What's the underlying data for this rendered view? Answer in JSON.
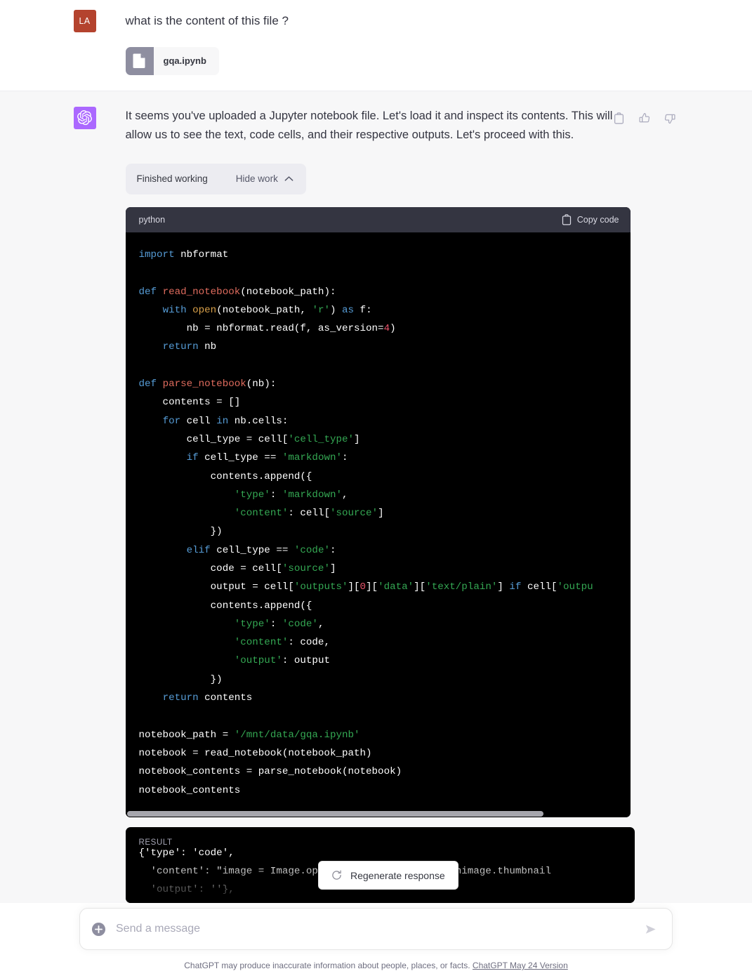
{
  "user_turn": {
    "avatar_initials": "LA",
    "avatar_color": "#b4432e",
    "text": "what is the content of this file ?",
    "attachment": {
      "filename": "gqa.ipynb",
      "icon": "file-icon"
    }
  },
  "assistant_turn": {
    "avatar_color": "#ab68ff",
    "avatar_icon": "openai-logo-icon",
    "text": "It seems you've uploaded a Jupyter notebook file. Let's load it and inspect its contents. This will allow us to see the text, code cells, and their respective outputs. Let's proceed with this.",
    "actions": [
      {
        "name": "copy-icon",
        "label": "Copy"
      },
      {
        "name": "thumbs-up-icon",
        "label": "Good response"
      },
      {
        "name": "thumbs-down-icon",
        "label": "Bad response"
      }
    ],
    "work_pill": {
      "status": "Finished working",
      "toggle_label": "Hide work",
      "chevron": "chevron-up-icon"
    },
    "code_block": {
      "language": "python",
      "copy_label": "Copy code",
      "copy_icon": "clipboard-icon",
      "scrollbar_thumb_percent": 83,
      "code_lines": [
        [
          [
            "kw",
            "import"
          ],
          [
            "pl",
            " nbformat"
          ]
        ],
        [],
        [
          [
            "kw",
            "def"
          ],
          [
            "pl",
            " "
          ],
          [
            "fn",
            "read_notebook"
          ],
          [
            "pl",
            "(notebook_path):"
          ]
        ],
        [
          [
            "pl",
            "    "
          ],
          [
            "kw",
            "with"
          ],
          [
            "pl",
            " "
          ],
          [
            "bi",
            "open"
          ],
          [
            "pl",
            "(notebook_path, "
          ],
          [
            "str",
            "'r'"
          ],
          [
            "pl",
            ") "
          ],
          [
            "kw",
            "as"
          ],
          [
            "pl",
            " f:"
          ]
        ],
        [
          [
            "pl",
            "        nb = nbformat.read(f, as_version="
          ],
          [
            "num",
            "4"
          ],
          [
            "pl",
            ")"
          ]
        ],
        [
          [
            "pl",
            "    "
          ],
          [
            "kw",
            "return"
          ],
          [
            "pl",
            " nb"
          ]
        ],
        [],
        [
          [
            "kw",
            "def"
          ],
          [
            "pl",
            " "
          ],
          [
            "fn",
            "parse_notebook"
          ],
          [
            "pl",
            "(nb):"
          ]
        ],
        [
          [
            "pl",
            "    contents = []"
          ]
        ],
        [
          [
            "pl",
            "    "
          ],
          [
            "kw",
            "for"
          ],
          [
            "pl",
            " cell "
          ],
          [
            "kw",
            "in"
          ],
          [
            "pl",
            " nb.cells:"
          ]
        ],
        [
          [
            "pl",
            "        cell_type = cell["
          ],
          [
            "str",
            "'cell_type'"
          ],
          [
            "pl",
            "]"
          ]
        ],
        [
          [
            "pl",
            "        "
          ],
          [
            "kw",
            "if"
          ],
          [
            "pl",
            " cell_type == "
          ],
          [
            "str",
            "'markdown'"
          ],
          [
            "pl",
            ":"
          ]
        ],
        [
          [
            "pl",
            "            contents.append({"
          ]
        ],
        [
          [
            "pl",
            "                "
          ],
          [
            "str",
            "'type'"
          ],
          [
            "pl",
            ": "
          ],
          [
            "str",
            "'markdown'"
          ],
          [
            "pl",
            ","
          ]
        ],
        [
          [
            "pl",
            "                "
          ],
          [
            "str",
            "'content'"
          ],
          [
            "pl",
            ": cell["
          ],
          [
            "str",
            "'source'"
          ],
          [
            "pl",
            "]"
          ]
        ],
        [
          [
            "pl",
            "            })"
          ]
        ],
        [
          [
            "pl",
            "        "
          ],
          [
            "kw",
            "elif"
          ],
          [
            "pl",
            " cell_type == "
          ],
          [
            "str",
            "'code'"
          ],
          [
            "pl",
            ":"
          ]
        ],
        [
          [
            "pl",
            "            code = cell["
          ],
          [
            "str",
            "'source'"
          ],
          [
            "pl",
            "]"
          ]
        ],
        [
          [
            "pl",
            "            output = cell["
          ],
          [
            "str",
            "'outputs'"
          ],
          [
            "pl",
            "]["
          ],
          [
            "num",
            "0"
          ],
          [
            "pl",
            "]["
          ],
          [
            "str",
            "'data'"
          ],
          [
            "pl",
            "]["
          ],
          [
            "str",
            "'text/plain'"
          ],
          [
            "pl",
            "] "
          ],
          [
            "kw",
            "if"
          ],
          [
            "pl",
            " cell["
          ],
          [
            "str",
            "'outpu"
          ]
        ],
        [
          [
            "pl",
            "            contents.append({"
          ]
        ],
        [
          [
            "pl",
            "                "
          ],
          [
            "str",
            "'type'"
          ],
          [
            "pl",
            ": "
          ],
          [
            "str",
            "'code'"
          ],
          [
            "pl",
            ","
          ]
        ],
        [
          [
            "pl",
            "                "
          ],
          [
            "str",
            "'content'"
          ],
          [
            "pl",
            ": code,"
          ]
        ],
        [
          [
            "pl",
            "                "
          ],
          [
            "str",
            "'output'"
          ],
          [
            "pl",
            ": output"
          ]
        ],
        [
          [
            "pl",
            "            })"
          ]
        ],
        [
          [
            "pl",
            "    "
          ],
          [
            "kw",
            "return"
          ],
          [
            "pl",
            " contents"
          ]
        ],
        [],
        [
          [
            "pl",
            "notebook_path = "
          ],
          [
            "str",
            "'/mnt/data/gqa.ipynb'"
          ]
        ],
        [
          [
            "pl",
            "notebook = read_notebook(notebook_path)"
          ]
        ],
        [
          [
            "pl",
            "notebook_contents = parse_notebook(notebook)"
          ]
        ],
        [
          [
            "pl",
            "notebook_contents"
          ]
        ]
      ]
    },
    "result_block": {
      "label": "RESULT",
      "lines": [
        "{'type': 'code',",
        "  'content': \"image = Image.open('/mnt/data/11.png')\\nimage.thumbnail",
        "  'output': ''},"
      ]
    }
  },
  "regenerate": {
    "label": "Regenerate response",
    "icon": "refresh-icon"
  },
  "composer": {
    "placeholder": "Send a message",
    "value": "",
    "plus_icon": "plus-circle-icon",
    "send_icon": "send-arrow-icon"
  },
  "footer": {
    "text": "ChatGPT may produce inaccurate information about people, places, or facts. ",
    "link_text": "ChatGPT May 24 Version"
  }
}
